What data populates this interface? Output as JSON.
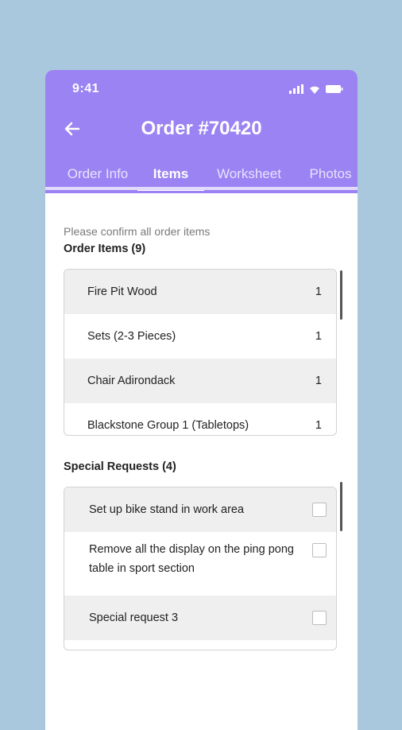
{
  "status": {
    "time": "9:41"
  },
  "header": {
    "title": "Order #70420"
  },
  "tabs": [
    {
      "label": "Order Info",
      "active": false
    },
    {
      "label": "Items",
      "active": true
    },
    {
      "label": "Worksheet",
      "active": false
    },
    {
      "label": "Photos",
      "active": false
    }
  ],
  "hint": "Please confirm all order items",
  "order_items": {
    "heading": "Order Items (9)",
    "items": [
      {
        "name": "Fire Pit Wood",
        "qty": "1"
      },
      {
        "name": "Sets (2-3 Pieces)",
        "qty": "1"
      },
      {
        "name": "Chair Adirondack",
        "qty": "1"
      },
      {
        "name": "Blackstone Group 1 (Tabletops)",
        "qty": "1"
      }
    ]
  },
  "special_requests": {
    "heading": "Special Requests (4)",
    "items": [
      {
        "text": "Set up bike stand in work area"
      },
      {
        "text": "Remove all the display on the ping pong table in sport section"
      },
      {
        "text": "Special request 3"
      }
    ]
  },
  "colors": {
    "accent": "#9b83f3",
    "background": "#a9c8de"
  }
}
